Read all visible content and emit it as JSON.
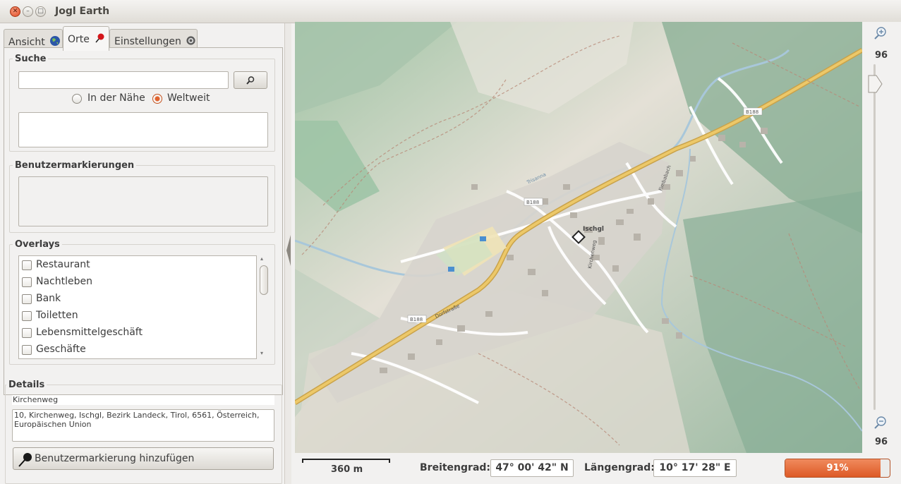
{
  "window": {
    "title": "Jogl Earth"
  },
  "tabs": [
    {
      "label": "Ansicht",
      "icon": "globe-icon"
    },
    {
      "label": "Orte",
      "icon": "pin-icon",
      "active": true
    },
    {
      "label": "Einstellungen",
      "icon": "gear-icon"
    }
  ],
  "search": {
    "group_label": "Suche",
    "input_value": "",
    "button_icon": "magnifier-icon",
    "radio_nearby": "In der Nähe",
    "radio_worldwide": "Weltweit",
    "selected": "worldwide",
    "results": []
  },
  "user_markers": {
    "group_label": "Benutzermarkierungen",
    "items": []
  },
  "overlays": {
    "group_label": "Overlays",
    "items": [
      {
        "label": "Restaurant",
        "checked": false
      },
      {
        "label": "Nachtleben",
        "checked": false
      },
      {
        "label": "Bank",
        "checked": false
      },
      {
        "label": "Toiletten",
        "checked": false
      },
      {
        "label": "Lebensmittelgeschäft",
        "checked": false
      },
      {
        "label": "Geschäfte",
        "checked": false
      }
    ]
  },
  "details": {
    "group_label": "Details",
    "name": "Kirchenweg",
    "address": "10, Kirchenweg, Ischgl, Bezirk Landeck, Tirol, 6561, Österreich, Europäischen Union",
    "add_marker_button": "Benutzermarkierung hinzufügen"
  },
  "map": {
    "place_label": "Ischgl",
    "road_labels": [
      "B188",
      "B188",
      "B188"
    ],
    "street_labels": [
      "Trisanna",
      "Dorfstraße",
      "Fimbabach",
      "Kirchenweg"
    ]
  },
  "zoom": {
    "top_value": "96",
    "bottom_value": "96",
    "level": 0.03
  },
  "status": {
    "scale_label": "360 m",
    "latitude_label": "Breitengrad:",
    "latitude_value": "47° 00' 42\" N",
    "longitude_label": "Längengrad:",
    "longitude_value": "10° 17' 28\" E",
    "progress_text": "91%",
    "progress": 0.91
  },
  "colors": {
    "accent": "#dd5a26",
    "forest": "#8fb59a",
    "road": "#e6b84f"
  }
}
